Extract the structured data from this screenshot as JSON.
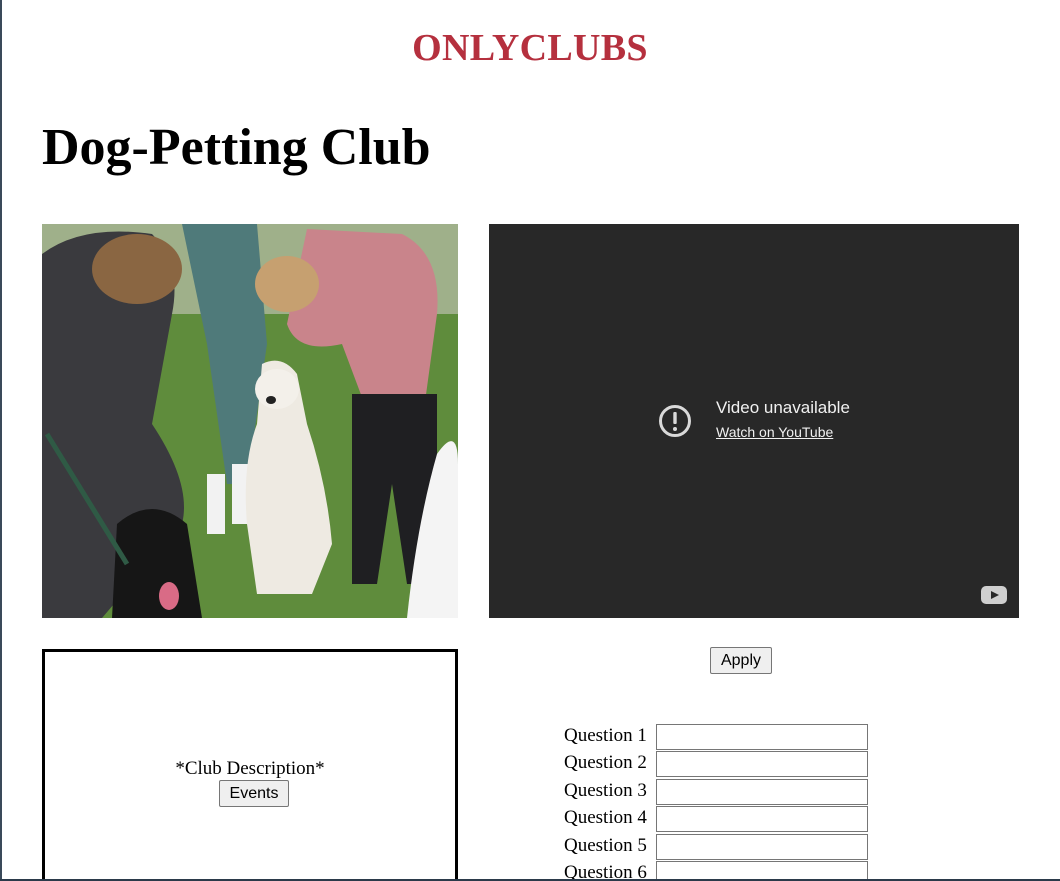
{
  "header": {
    "brand": "ONLYCLUBS"
  },
  "club": {
    "title": "Dog-Petting Club",
    "description": "*Club Description*"
  },
  "video": {
    "message": "Video unavailable",
    "link_label": "Watch on YouTube"
  },
  "buttons": {
    "events_label": "Events",
    "apply_label": "Apply"
  },
  "questions": [
    {
      "label": "Question 1",
      "value": ""
    },
    {
      "label": "Question 2",
      "value": ""
    },
    {
      "label": "Question 3",
      "value": ""
    },
    {
      "label": "Question 4",
      "value": ""
    },
    {
      "label": "Question 5",
      "value": ""
    },
    {
      "label": "Question 6",
      "value": ""
    }
  ],
  "colors": {
    "brand": "#b5303e",
    "video_bg": "#282828"
  },
  "icons": {
    "video_warning": "exclamation-circle-icon",
    "youtube": "youtube-logo-icon"
  }
}
